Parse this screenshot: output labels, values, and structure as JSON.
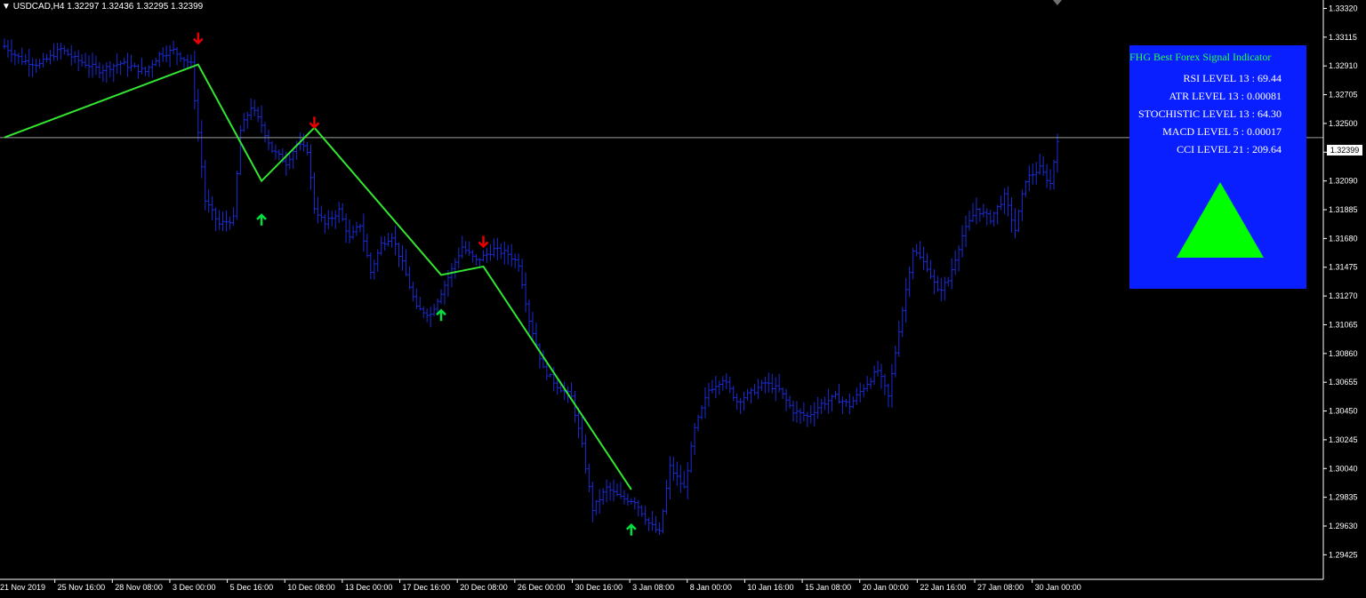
{
  "header": {
    "arrow": "▼",
    "symbol": "USDCAD,H4",
    "ohlc": "1.32297 1.32436 1.32295 1.32399"
  },
  "indicator": {
    "title": "FHG Best Forex Signal Indicator",
    "lines": [
      "RSI LEVEL 13 : 69.44",
      "ATR LEVEL 13 : 0.00081",
      "STOCHISTIC LEVEL 13 : 64.30",
      "MACD LEVEL 5 : 0.00017",
      "CCI LEVEL 21 : 209.64"
    ],
    "signal_icon": "up-triangle-icon",
    "panel_color": "#0a1fff",
    "signal_color": "#00ff00"
  },
  "chart_data": {
    "type": "bar",
    "symbol": "USDCAD",
    "timeframe": "H4",
    "current_price": 1.32399,
    "current_price_label": "1.32399",
    "ylim": [
      1.2925,
      1.3338
    ],
    "y_ticks": [
      "1.33320",
      "1.33115",
      "1.32910",
      "1.32705",
      "1.32500",
      "1.32295",
      "1.32090",
      "1.31885",
      "1.31680",
      "1.31475",
      "1.31270",
      "1.31065",
      "1.30860",
      "1.30655",
      "1.30450",
      "1.30245",
      "1.30040",
      "1.29835",
      "1.29630",
      "1.29425"
    ],
    "x_ticks": [
      "21 Nov 2019",
      "25 Nov 16:00",
      "28 Nov 08:00",
      "3 Dec 00:00",
      "5 Dec 16:00",
      "10 Dec 08:00",
      "13 Dec 00:00",
      "17 Dec 16:00",
      "20 Dec 08:00",
      "26 Dec 00:00",
      "30 Dec 16:00",
      "3 Jan 08:00",
      "8 Jan 00:00",
      "10 Jan 16:00",
      "15 Jan 08:00",
      "20 Jan 00:00",
      "22 Jan 16:00",
      "27 Jan 08:00",
      "30 Jan 00:00"
    ],
    "price_anchors": [
      [
        0,
        1.3305
      ],
      [
        5,
        1.3295
      ],
      [
        10,
        1.3292
      ],
      [
        16,
        1.3303
      ],
      [
        20,
        1.3296
      ],
      [
        27,
        1.3288
      ],
      [
        33,
        1.3293
      ],
      [
        40,
        1.3287
      ],
      [
        44,
        1.3299
      ],
      [
        48,
        1.3302
      ],
      [
        53,
        1.3292
      ],
      [
        57,
        1.3195
      ],
      [
        61,
        1.3178
      ],
      [
        65,
        1.3182
      ],
      [
        67,
        1.3245
      ],
      [
        70,
        1.3262
      ],
      [
        73,
        1.3249
      ],
      [
        76,
        1.3231
      ],
      [
        80,
        1.3222
      ],
      [
        83,
        1.3235
      ],
      [
        86,
        1.3231
      ],
      [
        88,
        1.319
      ],
      [
        91,
        1.3178
      ],
      [
        95,
        1.3188
      ],
      [
        98,
        1.3168
      ],
      [
        101,
        1.3178
      ],
      [
        104,
        1.3144
      ],
      [
        107,
        1.3164
      ],
      [
        110,
        1.317
      ],
      [
        113,
        1.315
      ],
      [
        117,
        1.3118
      ],
      [
        121,
        1.3114
      ],
      [
        125,
        1.3135
      ],
      [
        130,
        1.3162
      ],
      [
        134,
        1.3152
      ],
      [
        139,
        1.316
      ],
      [
        143,
        1.3157
      ],
      [
        146,
        1.315
      ],
      [
        149,
        1.311
      ],
      [
        153,
        1.3075
      ],
      [
        157,
        1.3063
      ],
      [
        161,
        1.3055
      ],
      [
        164,
        1.302
      ],
      [
        167,
        1.2975
      ],
      [
        171,
        1.299
      ],
      [
        175,
        1.2983
      ],
      [
        179,
        1.2981
      ],
      [
        183,
        1.2965
      ],
      [
        186,
        1.2958
      ],
      [
        189,
        1.3005
      ],
      [
        193,
        1.299
      ],
      [
        196,
        1.3032
      ],
      [
        200,
        1.306
      ],
      [
        204,
        1.3068
      ],
      [
        208,
        1.3052
      ],
      [
        212,
        1.3058
      ],
      [
        216,
        1.3065
      ],
      [
        220,
        1.306
      ],
      [
        224,
        1.3045
      ],
      [
        228,
        1.3041
      ],
      [
        232,
        1.305
      ],
      [
        236,
        1.3055
      ],
      [
        240,
        1.3049
      ],
      [
        244,
        1.3062
      ],
      [
        248,
        1.3074
      ],
      [
        251,
        1.3055
      ],
      [
        254,
        1.3103
      ],
      [
        258,
        1.316
      ],
      [
        262,
        1.3148
      ],
      [
        265,
        1.313
      ],
      [
        268,
        1.3138
      ],
      [
        272,
        1.317
      ],
      [
        276,
        1.3189
      ],
      [
        280,
        1.3182
      ],
      [
        284,
        1.3198
      ],
      [
        287,
        1.3174
      ],
      [
        290,
        1.321
      ],
      [
        294,
        1.3218
      ],
      [
        297,
        1.3207
      ],
      [
        299,
        1.3239
      ]
    ],
    "zigzag": [
      [
        1.324,
        0
      ],
      [
        1.3292,
        55
      ],
      [
        1.3209,
        73
      ],
      [
        1.3247,
        88
      ],
      [
        1.3142,
        124
      ],
      [
        1.3148,
        136
      ],
      [
        1.2989,
        178
      ]
    ],
    "signals": [
      {
        "direction": "down",
        "index": 55,
        "price": 1.3311
      },
      {
        "direction": "up",
        "index": 73,
        "price": 1.3181
      },
      {
        "direction": "down",
        "index": 88,
        "price": 1.3251
      },
      {
        "direction": "up",
        "index": 124,
        "price": 1.3113
      },
      {
        "direction": "down",
        "index": 136,
        "price": 1.3166
      },
      {
        "direction": "up",
        "index": 178,
        "price": 1.296
      }
    ],
    "bar_count": 300,
    "colors": {
      "background": "#000000",
      "bars": "#1c2bd6",
      "zigzag": "#32e632",
      "buy_arrow": "#00e040",
      "sell_arrow": "#e60000",
      "axis": "#ffffff",
      "price_line": "#9aa0a0"
    }
  }
}
